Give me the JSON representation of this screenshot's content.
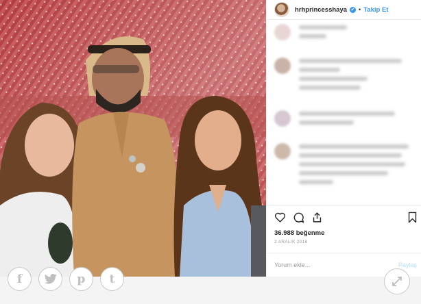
{
  "header": {
    "username": "hrhprincesshaya",
    "verified_glyph": "✔",
    "separator": "•",
    "follow_label": "Takip Et"
  },
  "post": {
    "likes": "36.988 beğenme",
    "date": "2 ARALIK 2018"
  },
  "comment_box": {
    "placeholder": "Yorum ekle...",
    "submit_label": "Paylaş"
  },
  "icons": {
    "like": "heart-icon",
    "comment": "comment-icon",
    "share": "share-icon",
    "save": "bookmark-icon"
  },
  "share_bar": {
    "facebook": "f",
    "twitter": "twitter-bird",
    "pinterest": "p",
    "tumblr": "t"
  },
  "colors": {
    "accent": "#3897f0",
    "tent_red": "#b03a3c",
    "bottom_bar": "#f4f4f4"
  }
}
